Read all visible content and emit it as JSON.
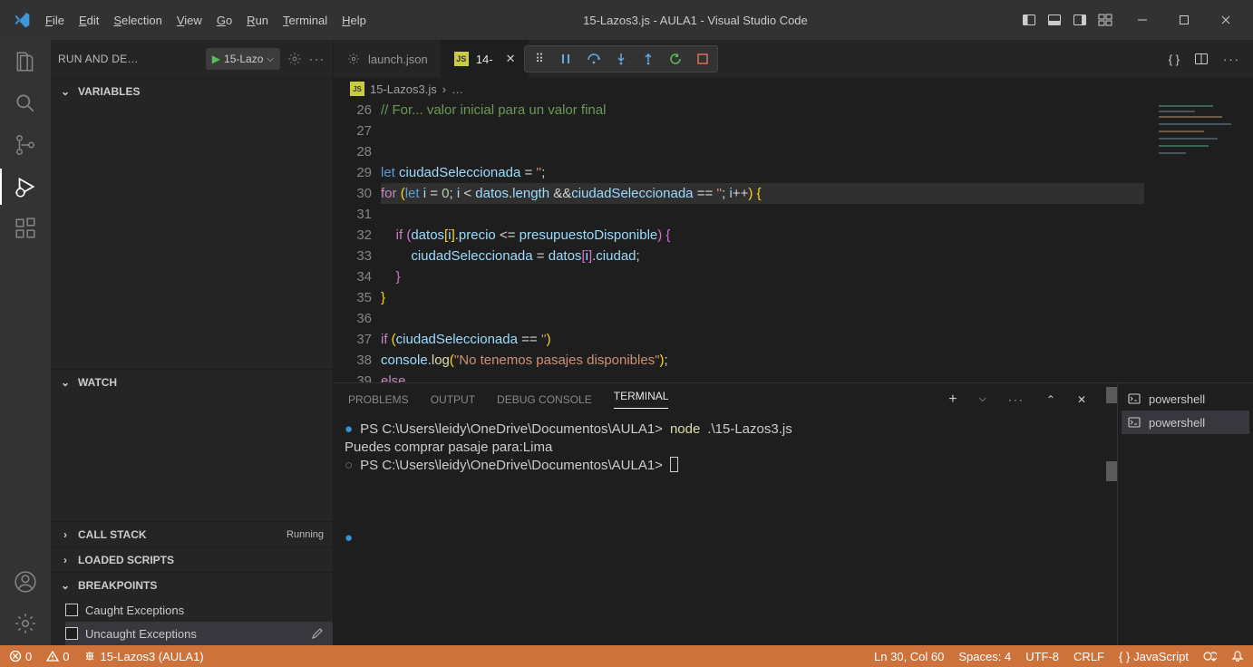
{
  "titlebar": {
    "title": "15-Lazos3.js - AULA1 - Visual Studio Code",
    "menus": [
      "File",
      "Edit",
      "Selection",
      "View",
      "Go",
      "Run",
      "Terminal",
      "Help"
    ]
  },
  "sidebar": {
    "head": {
      "title": "RUN AND DE…",
      "config": "15-Lazo"
    },
    "sections": {
      "variables": "VARIABLES",
      "watch": "WATCH",
      "callstack": "CALL STACK",
      "callstack_status": "Running",
      "loaded": "LOADED SCRIPTS",
      "breakpoints": "BREAKPOINTS"
    },
    "breakpoints": [
      {
        "label": "Caught Exceptions",
        "checked": false
      },
      {
        "label": "Uncaught Exceptions",
        "checked": false
      }
    ]
  },
  "tabs": [
    {
      "icon": "gear",
      "label": "launch.json"
    },
    {
      "icon": "js",
      "label": "14-"
    }
  ],
  "debug_icons": [
    "grip",
    "pause",
    "step-over",
    "step-into",
    "step-out",
    "restart",
    "stop",
    "close"
  ],
  "crumbs": {
    "icon": "js",
    "file": "15-Lazos3.js",
    "trail": "…"
  },
  "code": {
    "start": 26,
    "lines": [
      {
        "n": 26,
        "html": "<span class='tok-cm'>// For... valor inicial para un valor final</span>"
      },
      {
        "n": 27,
        "html": ""
      },
      {
        "n": 28,
        "html": ""
      },
      {
        "n": 29,
        "html": "<span class='tok-kw'>let</span> <span class='tok-var'>ciudadSeleccionada</span> <span class='tok-op'>=</span> <span class='tok-str'>''</span><span class='tok-op'>;</span>"
      },
      {
        "n": 30,
        "html": "<span class='tok-kw2'>for</span> <span class='tok-p2'>(</span><span class='tok-kw'>let</span> <span class='tok-var'>i</span> <span class='tok-op'>=</span> <span class='tok-num'>0</span><span class='tok-op'>; </span><span class='tok-var'>i</span> <span class='tok-op'>&lt;</span> <span class='tok-var'>datos</span><span class='tok-op'>.</span><span class='tok-prop'>length</span> <span class='tok-op'>&amp;&amp;</span><span class='tok-var'>ciudadSeleccionada</span> <span class='tok-op'>==</span> <span class='tok-str'>''</span><span class='tok-op'>; </span><span class='tok-var'>i</span><span class='tok-op'>++</span><span class='tok-p2'>)</span> <span class='tok-p2'>{</span>",
        "current": true
      },
      {
        "n": 31,
        "html": ""
      },
      {
        "n": 32,
        "html": "    <span class='tok-kw2'>if</span> <span class='tok-p'>(</span><span class='tok-var'>datos</span><span class='tok-p2'>[</span><span class='tok-var'>i</span><span class='tok-p2'>]</span><span class='tok-op'>.</span><span class='tok-prop'>precio</span> <span class='tok-op'>&lt;=</span> <span class='tok-var'>presupuestoDisponible</span><span class='tok-p'>)</span> <span class='tok-p'>{</span>"
      },
      {
        "n": 33,
        "html": "        <span class='tok-var'>ciudadSeleccionada</span> <span class='tok-op'>=</span> <span class='tok-var'>datos</span><span class='tok-p'>[</span><span class='tok-var'>i</span><span class='tok-p'>]</span><span class='tok-op'>.</span><span class='tok-prop'>ciudad</span><span class='tok-op'>;</span>"
      },
      {
        "n": 34,
        "html": "    <span class='tok-p'>}</span>"
      },
      {
        "n": 35,
        "html": "<span class='tok-p2'>}</span>"
      },
      {
        "n": 36,
        "html": ""
      },
      {
        "n": 37,
        "html": "<span class='tok-kw2'>if</span> <span class='tok-p2'>(</span><span class='tok-var'>ciudadSeleccionada</span> <span class='tok-op'>==</span> <span class='tok-str'>''</span><span class='tok-p2'>)</span>"
      },
      {
        "n": 38,
        "html": "<span class='tok-var'>console</span><span class='tok-op'>.</span><span class='tok-fn'>log</span><span class='tok-p2'>(</span><span class='tok-str'>\"No tenemos pasajes disponibles\"</span><span class='tok-p2'>)</span><span class='tok-op'>;</span>"
      },
      {
        "n": 39,
        "html": "<span class='tok-kw2'>else</span>"
      }
    ]
  },
  "panel": {
    "tabs": [
      "PROBLEMS",
      "OUTPUT",
      "DEBUG CONSOLE",
      "TERMINAL"
    ],
    "active": "TERMINAL",
    "terminal": {
      "lines": [
        {
          "bullet": "●",
          "cls": "",
          "prefix": "PS C:\\Users\\leidy\\OneDrive\\Documentos\\AULA1>",
          "cmd": "node",
          "arg": ".\\15-Lazos3.js"
        },
        {
          "plain": "Puedes comprar pasaje para:Lima"
        },
        {
          "bullet": "○",
          "cls": "dim",
          "prefix": "PS C:\\Users\\leidy\\OneDrive\\Documentos\\AULA1>",
          "cursor": true
        }
      ]
    },
    "sessions": [
      {
        "label": "powershell"
      },
      {
        "label": "powershell",
        "active": true
      }
    ]
  },
  "status": {
    "left": [
      {
        "icon": "err",
        "text": "0"
      },
      {
        "icon": "warn",
        "text": "0"
      },
      {
        "icon": "debug",
        "text": "15-Lazos3 (AULA1)"
      }
    ],
    "right": [
      {
        "text": "Ln 30, Col 60"
      },
      {
        "text": "Spaces: 4"
      },
      {
        "text": "UTF-8"
      },
      {
        "text": "CRLF"
      },
      {
        "icon": "brace",
        "text": " JavaScript"
      },
      {
        "icon": "feedback"
      },
      {
        "icon": "bell"
      }
    ]
  }
}
